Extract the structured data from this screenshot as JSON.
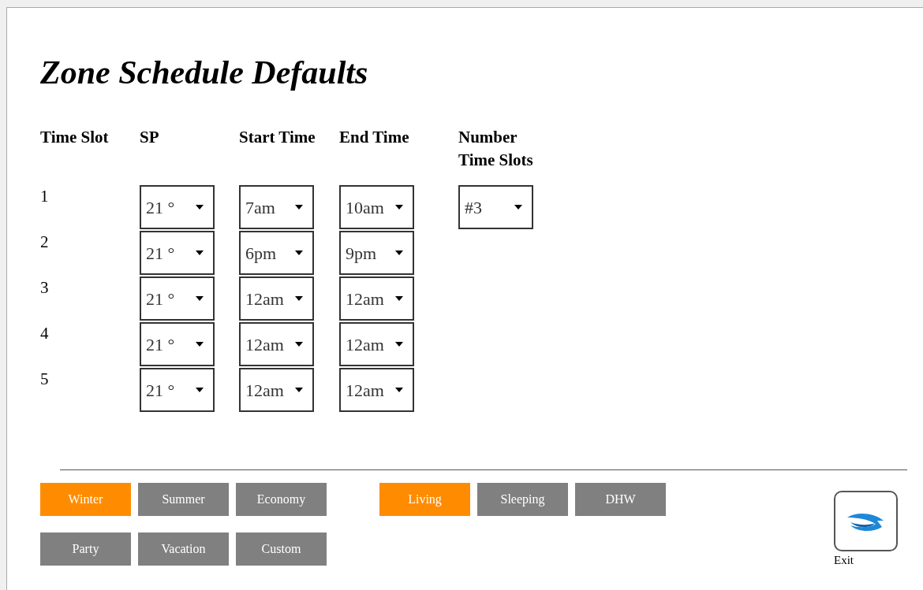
{
  "title": "Zone Schedule Defaults",
  "columns": [
    "Time Slot",
    "SP",
    "Start Time",
    "End Time",
    "Number Time Slots"
  ],
  "slots": [
    {
      "label": "1",
      "sp": "21 °",
      "start": "7am",
      "end": "10am"
    },
    {
      "label": "2",
      "sp": "21 °",
      "start": "6pm",
      "end": "9pm"
    },
    {
      "label": "3",
      "sp": "21 °",
      "start": "12am",
      "end": "12am"
    },
    {
      "label": "4",
      "sp": "21 °",
      "start": "12am",
      "end": "12am"
    },
    {
      "label": "5",
      "sp": "21 °",
      "start": "12am",
      "end": "12am"
    }
  ],
  "number_time_slots": "#3",
  "modes": [
    {
      "label": "Winter",
      "selected": true
    },
    {
      "label": "Summer",
      "selected": false
    },
    {
      "label": "Economy",
      "selected": false
    },
    {
      "label": "Party",
      "selected": false
    },
    {
      "label": "Vacation",
      "selected": false
    },
    {
      "label": "Custom",
      "selected": false
    }
  ],
  "zones": [
    {
      "label": "Living",
      "selected": true
    },
    {
      "label": "Sleeping",
      "selected": false
    },
    {
      "label": "DHW",
      "selected": false
    }
  ],
  "exit_label": "Exit"
}
